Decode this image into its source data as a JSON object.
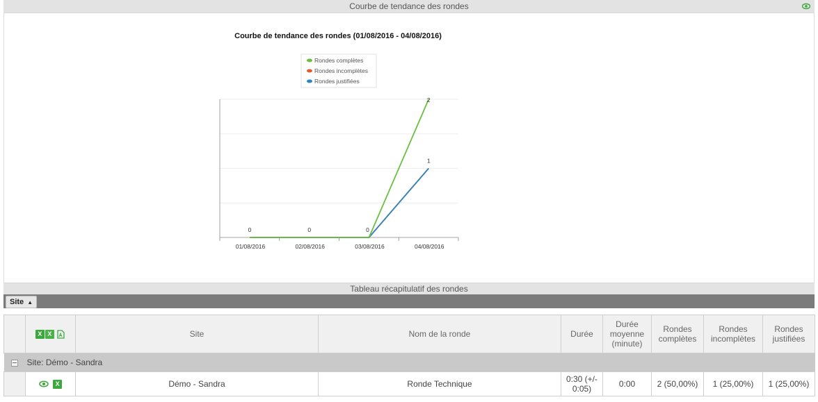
{
  "header": {
    "title": "Courbe de tendance des rondes"
  },
  "chart_data": {
    "type": "line",
    "title": "Courbe de tendance des rondes (01/08/2016 - 04/08/2016)",
    "categories": [
      "01/08/2016",
      "02/08/2016",
      "03/08/2016",
      "04/08/2016"
    ],
    "series": [
      {
        "name": "Rondes complètes",
        "color": "#6abf3f",
        "values": [
          0,
          0,
          0,
          2
        ]
      },
      {
        "name": "Rondes incomplètes",
        "color": "#e8582d",
        "values": [
          0,
          0,
          0,
          1
        ]
      },
      {
        "name": "Rondes justifiées",
        "color": "#2e86c1",
        "values": [
          0,
          0,
          0,
          1
        ]
      }
    ],
    "data_labels": [
      "0",
      "0",
      "0",
      "2",
      "1"
    ],
    "ylim": [
      0,
      2
    ],
    "legend_position": "top"
  },
  "table_section": {
    "title": "Tableau récapitulatif des rondes",
    "group_by_label": "Site",
    "columns": [
      "Site",
      "Nom de la ronde",
      "Durée",
      "Durée moyenne (minute)",
      "Rondes complètes",
      "Rondes incomplètes",
      "Rondes justifiées"
    ],
    "export_icons": [
      "excel-icon",
      "excel-export-icon",
      "pdf-icon"
    ],
    "group_label": "Site: Démo - Sandra",
    "rows": [
      {
        "site": "Démo - Sandra",
        "ronde": "Ronde Technique",
        "duree": "0:30 (+/- 0:05)",
        "duree_moyenne": "0:00",
        "completes": "2 (50,00%)",
        "incompletes": "1 (25,00%)",
        "justifiees": "1 (25,00%)"
      }
    ]
  },
  "colors": {
    "accent_green": "#3aa83a",
    "group_bar": "#7b7b7b"
  }
}
